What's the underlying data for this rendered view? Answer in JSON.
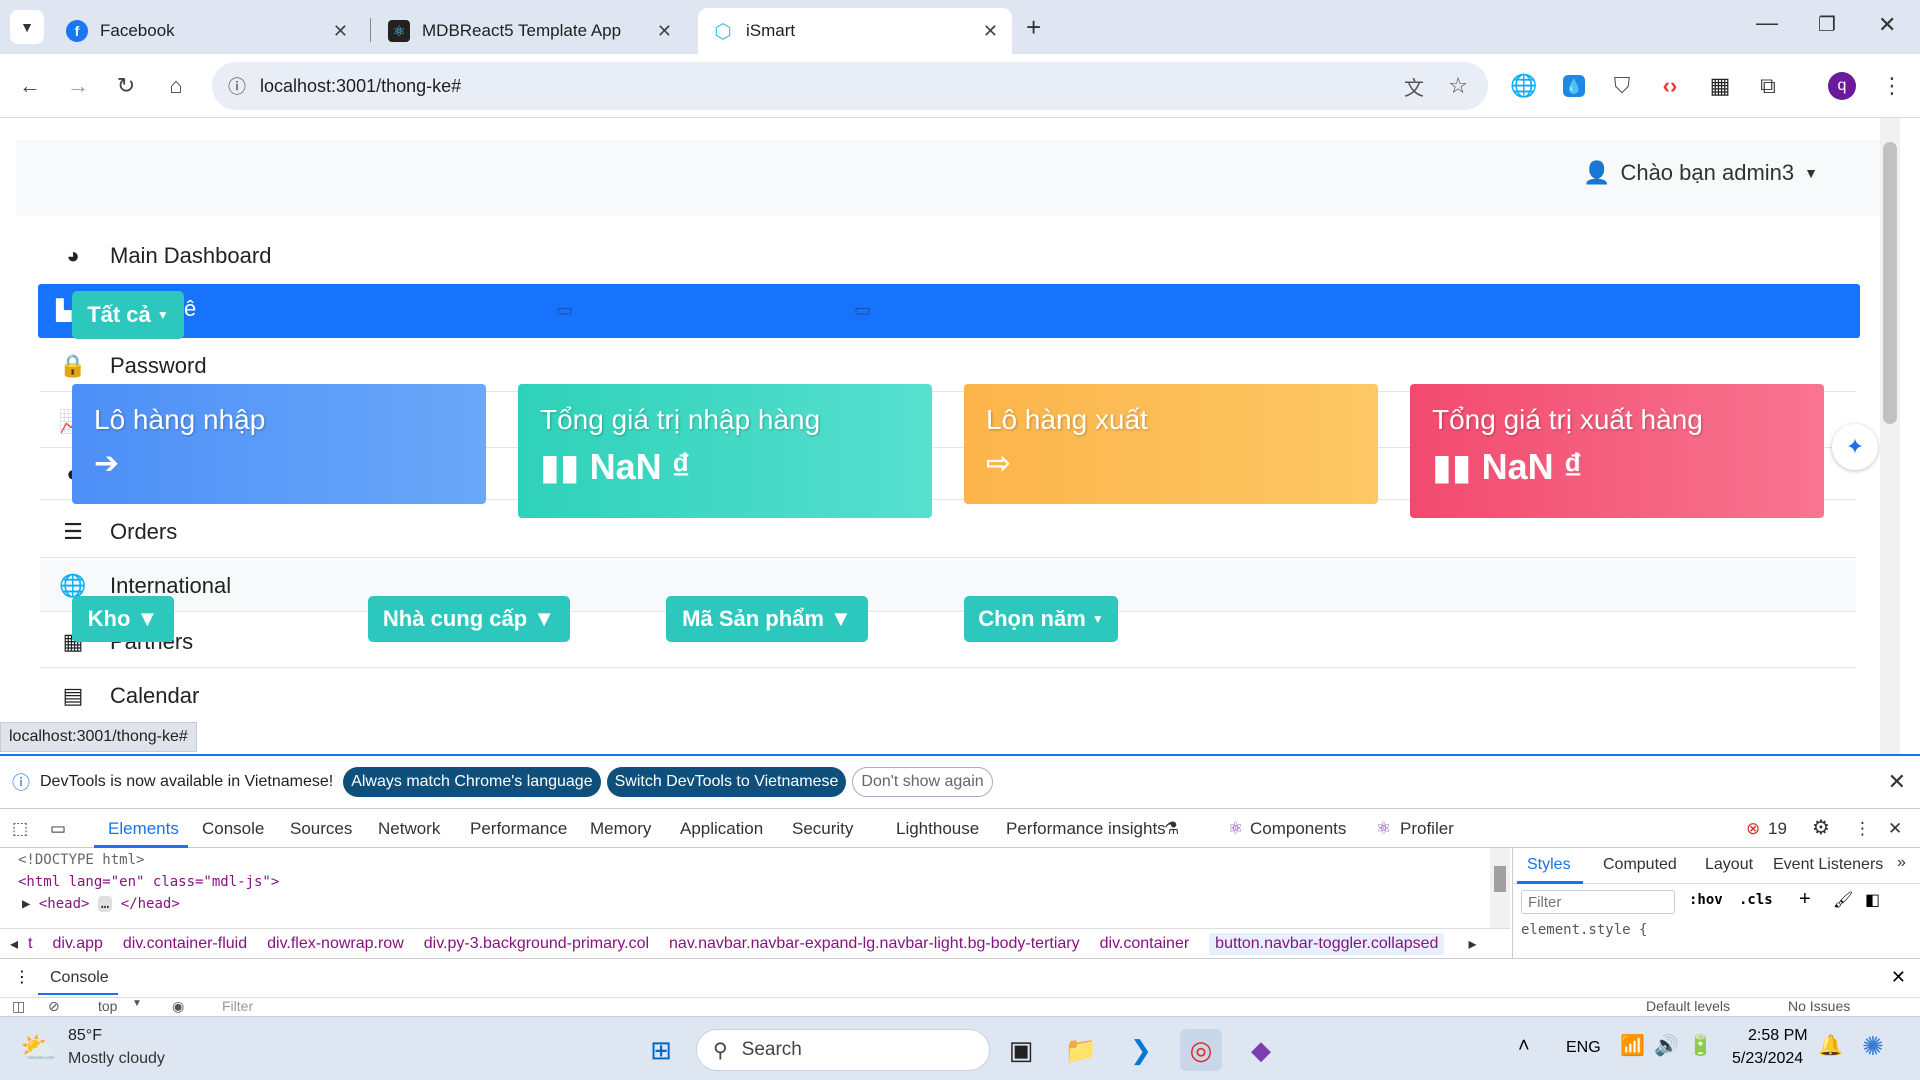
{
  "browser": {
    "tabs": [
      {
        "title": "Facebook",
        "icon": "facebook-icon",
        "color": "#1877f2"
      },
      {
        "title": "MDBReact5 Template App",
        "icon": "react-icon",
        "color": "#222"
      },
      {
        "title": "iSmart",
        "icon": "react-icon",
        "color": "#3fc3d3",
        "active": true
      }
    ],
    "url": "localhost:3001/thong-ke#",
    "status_url": "localhost:3001/thong-ke#",
    "profile_initial": "q"
  },
  "page": {
    "greeting": "Chào bạn admin3",
    "sidebar": [
      {
        "label": "Main Dashboard",
        "icon": "dashboard-icon"
      },
      {
        "label": "ê",
        "icon": "chart-icon"
      },
      {
        "label": "Password",
        "icon": "lock-icon"
      },
      {
        "label": "Orders",
        "icon": "list-icon"
      },
      {
        "label": "International",
        "icon": "globe-icon"
      },
      {
        "label": "Partners",
        "icon": "building-icon"
      },
      {
        "label": "Calendar",
        "icon": "calendar-icon"
      }
    ],
    "filter_all": "Tất cả",
    "cards": [
      {
        "title": "Lô hàng nhập",
        "value": "",
        "icon": "arrow-in-icon",
        "color": "#4d8ff7"
      },
      {
        "title": "Tổng giá trị nhập hàng",
        "value": "NaN ₫",
        "icon": "bar-chart-icon",
        "color": "#37d9c2"
      },
      {
        "title": "Lô hàng xuất",
        "value": "",
        "icon": "arrow-out-icon",
        "color": "#fcbb4f"
      },
      {
        "title": "Tổng giá trị xuất hàng",
        "value": "NaN ₫",
        "icon": "bar-chart-icon",
        "color": "#f4587a"
      }
    ],
    "dropdowns": [
      "Kho ▼",
      "Nhà cung cấp ▼",
      "Mã Sản phẩm ▼",
      "Chọn năm"
    ]
  },
  "devtools": {
    "info_text": "DevTools is now available in Vietnamese!",
    "btn_match": "Always match Chrome's language",
    "btn_switch": "Switch DevTools to Vietnamese",
    "btn_dont": "Don't show again",
    "tabs": [
      "Elements",
      "Console",
      "Sources",
      "Network",
      "Performance",
      "Memory",
      "Application",
      "Security",
      "Lighthouse",
      "Performance insights",
      "Components",
      "Profiler"
    ],
    "error_count": "19",
    "code_lines": [
      "<!DOCTYPE html>",
      "<html lang=\"en\" class=\"mdl-js\">",
      "<head>",
      "</head>"
    ],
    "styles_tabs": [
      "Styles",
      "Computed",
      "Layout",
      "Event Listeners"
    ],
    "filter_placeholder": "Filter",
    "hov": ":hov",
    "cls": ".cls",
    "element_style": "element.style {",
    "crumbs": [
      "t",
      "div.app",
      "div.container-fluid",
      "div.flex-nowrap.row",
      "div.py-3.background-primary.col",
      "nav.navbar.navbar-expand-lg.navbar-light.bg-body-tertiary",
      "div.container",
      "button.navbar-toggler.collapsed"
    ],
    "console_label": "Console",
    "console_top": "top",
    "console_filter": "Filter",
    "default_levels": "Default levels",
    "no_issues": "No Issues"
  },
  "taskbar": {
    "weather_temp": "85°F",
    "weather_desc": "Mostly cloudy",
    "search": "Search",
    "lang": "ENG",
    "time": "2:58 PM",
    "date": "5/23/2024"
  }
}
